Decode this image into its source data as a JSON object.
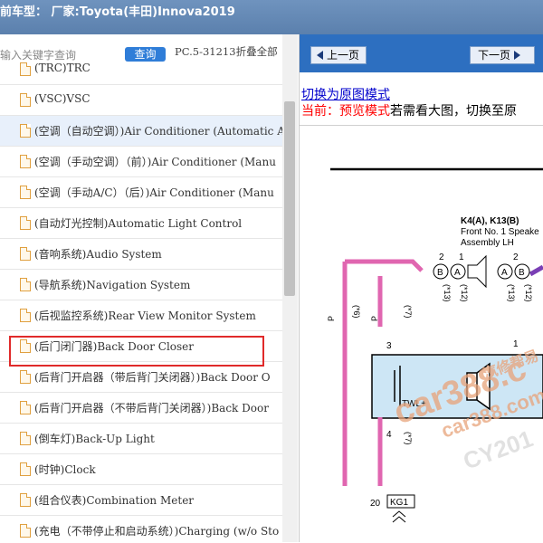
{
  "titlebar": {
    "text": "前车型：  厂家:Toyota(丰田)Innova2019"
  },
  "search": {
    "placeholder": "输入关键字查询",
    "button": "查询",
    "code": "PC.5-31213折叠全部"
  },
  "list": [
    "(TRC)TRC",
    "(VSC)VSC",
    "(空调（自动空调）)Air Conditioner (Automatic A",
    "(空调（手动空调）（前）)Air Conditioner (Manu",
    "(空调（手动A/C）（后）)Air Conditioner (Manu",
    "(自动灯光控制)Automatic Light Control",
    "(音响系统)Audio System",
    "(导航系统)Navigation System",
    "(后视监控系统)Rear View Monitor System",
    "(后门闭门器)Back Door Closer",
    "(后背门开启器（带后背门关闭器）)Back Door O",
    "(后背门开启器（不带后背门关闭器）)Back Door",
    "(倒车灯)Back-Up Light",
    "(时钟)Clock",
    "(组合仪表)Combination Meter",
    "(充电（不带停止和启动系统）)Charging (w/o Sto"
  ],
  "nav": {
    "prev": "上一页",
    "next": "下一页"
  },
  "links": {
    "switch": "切换为原图模式",
    "current_prefix": "当前：",
    "current_mode": "预览模式",
    "current_suffix": "若需看大图，切换至原"
  },
  "diagram": {
    "component": "K4(A), K13(B)",
    "desc1": "Front No. 1 Speake",
    "desc2": "Assembly LH",
    "pins_top": [
      "2",
      "1",
      "2"
    ],
    "pin_letters": [
      "B",
      "A",
      "A",
      "B"
    ],
    "wire_codes": [
      "(*13)",
      "(*12)",
      "(*13)",
      "(*12)"
    ],
    "wire_p": "P",
    "wire_6": "(*6)",
    "wire_7a": "(*7)",
    "wire_7b": "(*7)",
    "pin3": "3",
    "pin4": "4",
    "pin1": "1",
    "pin20": "20",
    "twl": "TWL+",
    "kg1": "KG1",
    "watermark1": "car388.c",
    "watermark2": "car388.com",
    "watermark3": "CY201",
    "wm_logo": "汽修帮易",
    "colors": {
      "pink": "#e066b0",
      "purple": "#7a3fb5",
      "box": "#cde6f5",
      "wm": "#e8a37a"
    }
  }
}
